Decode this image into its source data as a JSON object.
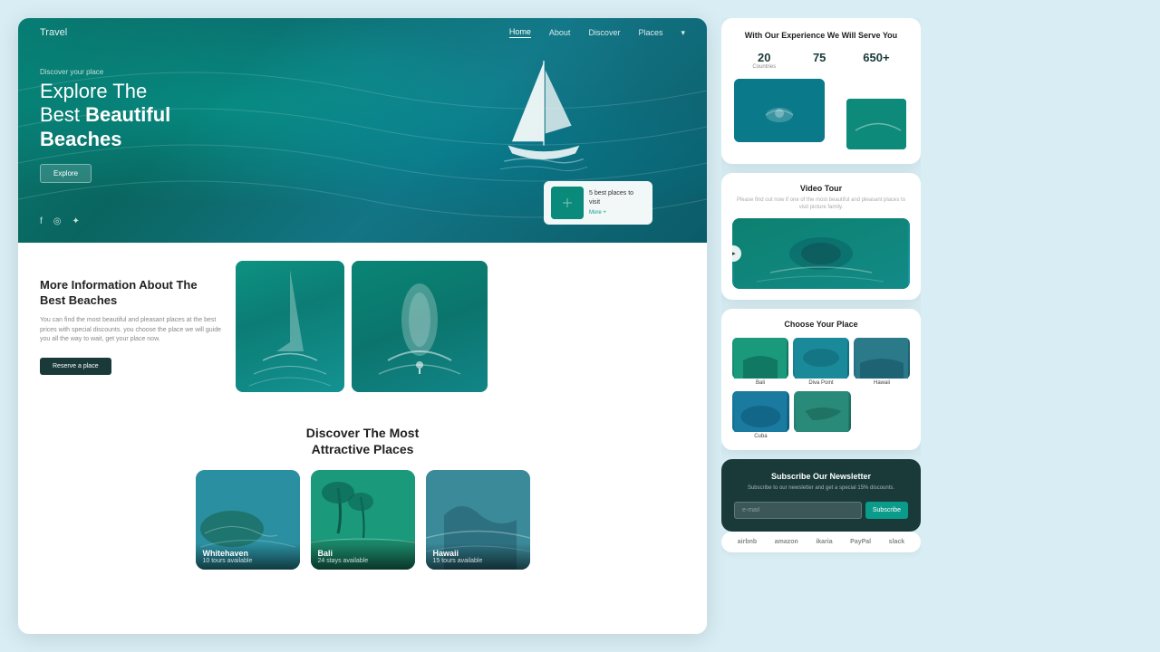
{
  "page": {
    "bg_color": "#d8eef4"
  },
  "nav": {
    "logo": "Travel",
    "links": [
      "Home",
      "About",
      "Discover",
      "Places"
    ],
    "active": "Home"
  },
  "hero": {
    "discover_label": "Discover your place",
    "title_line1": "Explore The",
    "title_line2_normal": "Best ",
    "title_line2_bold": "Beautiful",
    "title_line3": "Beaches",
    "cta_button": "Explore",
    "card_title": "5 best places to visit",
    "card_more": "More +"
  },
  "middle": {
    "title": "More Information About The Best Beaches",
    "description": "You can find the most beautiful and pleasant places at the best prices with special discounts. you choose the place we will guide you all the way to wait, get your place now.",
    "cta": "Reserve a place"
  },
  "discover": {
    "title_line1": "Discover The Most",
    "title_line2": "Attractive Places",
    "places": [
      {
        "name": "Whitehaven",
        "tours": "10 tours available",
        "color": "place-whitehaven"
      },
      {
        "name": "Bali",
        "tours": "24 stays available",
        "color": "place-bali"
      },
      {
        "name": "Hawaii",
        "tours": "15 tours available",
        "color": "place-hawaii"
      }
    ]
  },
  "right_panel": {
    "experience": {
      "title": "With Our Experience We Will Serve You",
      "stats": [
        {
          "number": "20",
          "label": "Countries"
        },
        {
          "number": "75",
          "label": ""
        },
        {
          "number": "650+",
          "label": ""
        }
      ]
    },
    "video_tour": {
      "title": "Video Tour",
      "description": "Please find out now if one of the most beautiful and pleasant places to visit picture family."
    },
    "choose": {
      "title": "Choose Your Place",
      "row1": [
        {
          "label": "Bali",
          "color": "cp-1"
        },
        {
          "label": "Diva Point",
          "color": "cp-2"
        },
        {
          "label": "Hawaii",
          "color": "cp-3"
        }
      ],
      "row2": [
        {
          "label": "Cuba",
          "color": "cp-4"
        },
        {
          "label": "",
          "color": "cp-5"
        }
      ]
    },
    "subscribe": {
      "title": "Subscribe Our Newsletter",
      "description": "Subscribe to our newsletter and get a special 15% discounts.",
      "placeholder": "e-mail",
      "button": "Subscribe"
    },
    "brands": [
      "airbnb",
      "amazon",
      "ikaria",
      "PayPal",
      "slack"
    ]
  },
  "social": {
    "icons": [
      "fb",
      "ig",
      "tw"
    ]
  }
}
